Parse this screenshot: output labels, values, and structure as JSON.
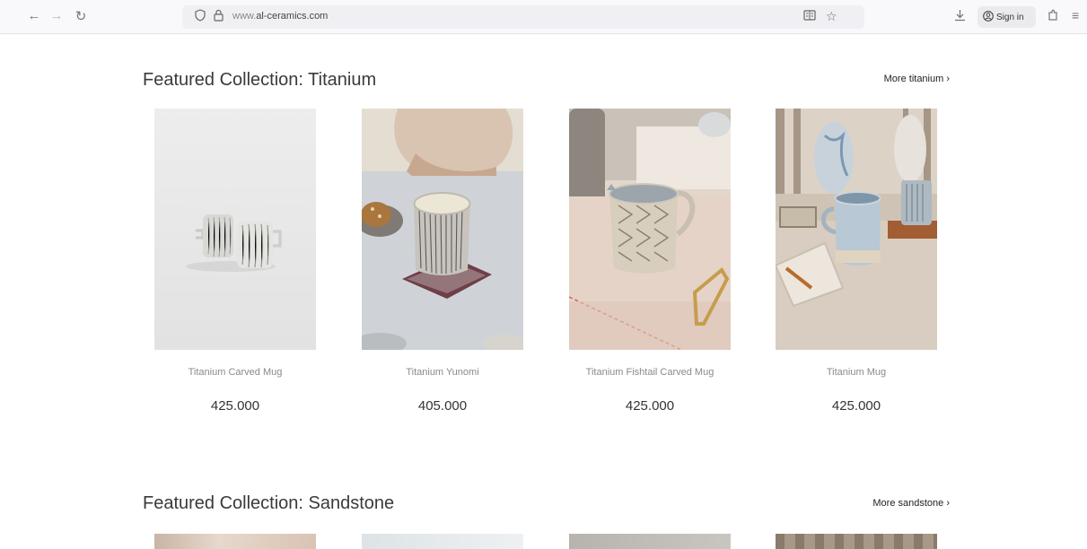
{
  "browser": {
    "url_prefix": "www.",
    "url_domain": "al-ceramics.com",
    "signin_label": "Sign in",
    "icons": {
      "back": "arrow-left-icon",
      "forward": "arrow-right-icon",
      "reload": "reload-icon",
      "shield": "shield-icon",
      "lock": "lock-icon",
      "reader": "reader-view-icon",
      "bookmark": "star-icon",
      "download": "download-icon",
      "account": "account-icon",
      "extensions": "extensions-icon",
      "menu": "hamburger-menu-icon"
    }
  },
  "sections": [
    {
      "title": "Featured Collection: Titanium",
      "more": "More titanium ›",
      "products": [
        {
          "name": "Titanium Carved Mug",
          "price": "425.000"
        },
        {
          "name": "Titanium Yunomi",
          "price": "405.000"
        },
        {
          "name": "Titanium Fishtail Carved Mug",
          "price": "425.000"
        },
        {
          "name": "Titanium Mug",
          "price": "425.000"
        }
      ]
    },
    {
      "title": "Featured Collection: Sandstone",
      "more": "More sandstone ›"
    }
  ]
}
